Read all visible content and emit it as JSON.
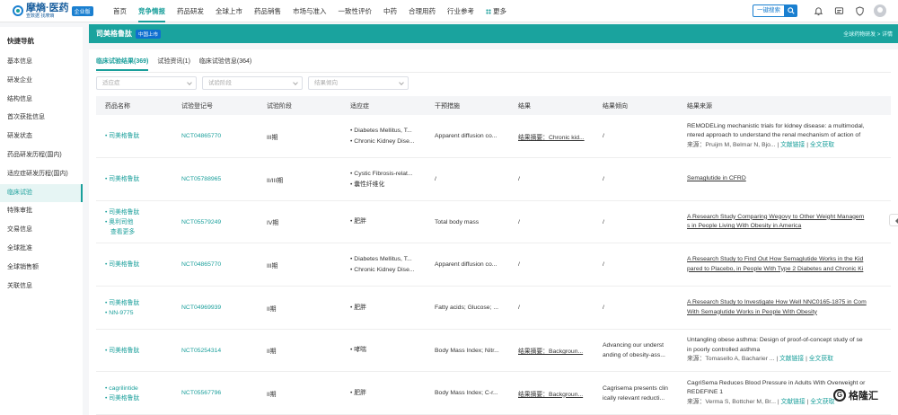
{
  "brand": {
    "title": "摩熵·医药",
    "subtitle": "查数据 找摩熵",
    "badge": "企业版"
  },
  "topnav": [
    "首页",
    "竞争情报",
    "药品研发",
    "全球上市",
    "药品销售",
    "市场与准入",
    "一致性评价",
    "中药",
    "合理用药",
    "行业参考",
    "更多"
  ],
  "topnav_active": "竞争情报",
  "search_button": "一键搜索",
  "banner": {
    "title": "司美格鲁肽",
    "badge": "中国上市",
    "breadcrumb": "全球药物研发 > 详情"
  },
  "sidebar": {
    "title": "快捷导航",
    "items": [
      "基本信息",
      "研发企业",
      "结构信息",
      "首次获批信息",
      "研发状态",
      "药品研发历程(国内)",
      "适应症研发历程(国内)",
      "临床试验",
      "特殊审批",
      "交易信息",
      "全球批准",
      "全球销售额",
      "关联信息"
    ],
    "active": "临床试验"
  },
  "tabs": [
    "临床试验结果(369)",
    "试验资讯(1)",
    "临床试验信息(364)"
  ],
  "filters": [
    "适应症",
    "试验阶段",
    "结果倾向"
  ],
  "table": {
    "headers": [
      "药品名称",
      "试验登记号",
      "试验阶段",
      "适应症",
      "干预措施",
      "结果",
      "结果倾向",
      "结果来源"
    ],
    "rows": [
      {
        "drugs": [
          "司美格鲁肽"
        ],
        "more": "",
        "reg": "NCT04865770",
        "phase": "III期",
        "indications": [
          "Diabetes Mellitus, T...",
          "Chronic Kidney Dise..."
        ],
        "intervention": "Apparent diffusion co...",
        "result": "结果摘要：Chronic kid...",
        "result_u": true,
        "tendency": [
          "/"
        ],
        "source_title": [
          "REMODELing mechanistic trials for kidney disease: a multimodal,",
          "ntered approach to understand the renal mechanism of action of"
        ],
        "source_title_u": false,
        "source_meta": "来源：Pruijm M, Belmar N, Bjo... ",
        "link1": "文献链接",
        "link2": "全文获取"
      },
      {
        "drugs": [
          "司美格鲁肽"
        ],
        "more": "",
        "reg": "NCT05788965",
        "phase": "II/III期",
        "indications": [
          "Cystic Fibrosis-relat...",
          "囊性纤维化"
        ],
        "intervention": "/",
        "result": "/",
        "result_u": false,
        "tendency": [
          "/"
        ],
        "source_title": [
          "Semaglutide in CFRD"
        ],
        "source_title_u": true,
        "source_meta": "",
        "link1": "",
        "link2": ""
      },
      {
        "drugs": [
          "司美格鲁肽",
          "奥利司他"
        ],
        "more": "查看更多",
        "reg": "NCT05579249",
        "phase": "IV期",
        "indications": [
          "肥胖"
        ],
        "intervention": "Total body mass",
        "result": "/",
        "result_u": false,
        "tendency": [
          "/"
        ],
        "source_title": [
          "A Research Study Comparing Wegovy to Other Weight Managem",
          "s in People Living With Obesity in America"
        ],
        "source_title_u": true,
        "source_meta": "",
        "link1": "",
        "link2": ""
      },
      {
        "drugs": [
          "司美格鲁肽"
        ],
        "more": "",
        "reg": "NCT04865770",
        "phase": "III期",
        "indications": [
          "Diabetes Mellitus, T...",
          "Chronic Kidney Dise..."
        ],
        "intervention": "Apparent diffusion co...",
        "result": "/",
        "result_u": false,
        "tendency": [
          "/"
        ],
        "source_title": [
          "A Research Study to Find Out How Semaglutide Works in the Kid",
          "pared to Placebo, in People With Type 2 Diabetes and Chronic Ki"
        ],
        "source_title_u": true,
        "source_meta": "",
        "link1": "",
        "link2": ""
      },
      {
        "drugs": [
          "司美格鲁肽",
          "NN-9775"
        ],
        "more": "",
        "reg": "NCT04969939",
        "phase": "II期",
        "indications": [
          "肥胖"
        ],
        "intervention": "Fatty acids; Glucose; ...",
        "result": "/",
        "result_u": false,
        "tendency": [
          "/"
        ],
        "source_title": [
          "A Research Study to Investigate How Well NNC0165-1875 in Com",
          "With Semaglutide Works in People With Obesity"
        ],
        "source_title_u": true,
        "source_meta": "",
        "link1": "",
        "link2": ""
      },
      {
        "drugs": [
          "司美格鲁肽"
        ],
        "more": "",
        "reg": "NCT05254314",
        "phase": "II期",
        "indications": [
          "哮喘"
        ],
        "intervention": "Body Mass Index; Nitr...",
        "result": "结果摘要：Backgroun...",
        "result_u": true,
        "tendency": [
          "Advancing our underst",
          "anding of obesity-ass..."
        ],
        "source_title": [
          "Untangling obese asthma: Design of proof-of-concept study of se",
          "in poorly controlled asthma"
        ],
        "source_title_u": false,
        "source_meta": "来源：Tomasello A, Bacharier ... ",
        "link1": "文献链接",
        "link2": "全文获取"
      },
      {
        "drugs": [
          "cagrilintide",
          "司美格鲁肽"
        ],
        "more": "",
        "reg": "NCT05567796",
        "phase": "II期",
        "indications": [
          "肥胖"
        ],
        "intervention": "Body Mass Index; C-r...",
        "result": "结果摘要：Backgroun...",
        "result_u": true,
        "tendency": [
          "Cagrisema presents clin",
          "ically relevant reducti..."
        ],
        "source_title": [
          "CagriSema Reduces Blood Pressure in Adults With Overweight or",
          "REDEFINE 1"
        ],
        "source_title_u": false,
        "source_meta": "来源：Verma S, Bottcher M, Br... ",
        "link1": "文献链接",
        "link2": "全文获取"
      }
    ]
  },
  "watermark": "格隆汇"
}
